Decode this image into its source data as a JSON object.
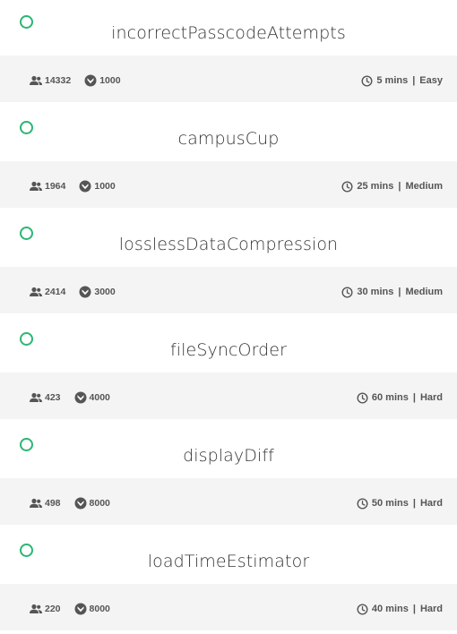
{
  "colors": {
    "status_ring": "#2bb673",
    "title_text": "#333333",
    "meta_bar_bg": "#f4f4f4",
    "meta_text": "#555555"
  },
  "icons": {
    "status": "circle-outline-icon",
    "solvers": "people-icon",
    "points": "badge-shield-icon",
    "duration": "clock-icon"
  },
  "separator": "|",
  "tasks": [
    {
      "title": "incorrectPasscodeAttempts",
      "solvers": "14332",
      "points": "1000",
      "duration": "5 mins",
      "difficulty": "Easy"
    },
    {
      "title": "campusCup",
      "solvers": "1964",
      "points": "1000",
      "duration": "25 mins",
      "difficulty": "Medium"
    },
    {
      "title": "losslessDataCompression",
      "solvers": "2414",
      "points": "3000",
      "duration": "30 mins",
      "difficulty": "Medium"
    },
    {
      "title": "fileSyncOrder",
      "solvers": "423",
      "points": "4000",
      "duration": "60 mins",
      "difficulty": "Hard"
    },
    {
      "title": "displayDiff",
      "solvers": "498",
      "points": "8000",
      "duration": "50 mins",
      "difficulty": "Hard"
    },
    {
      "title": "loadTimeEstimator",
      "solvers": "220",
      "points": "8000",
      "duration": "40 mins",
      "difficulty": "Hard"
    }
  ]
}
